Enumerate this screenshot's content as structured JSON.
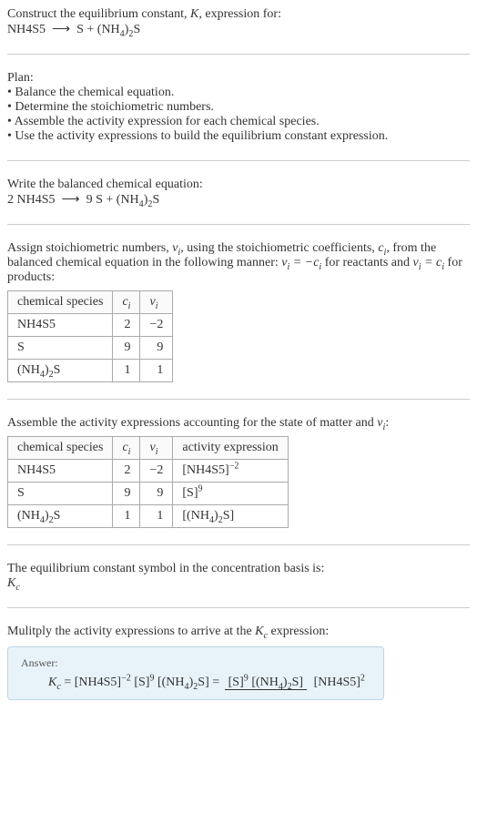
{
  "intro": {
    "line1_pre": "Construct the equilibrium constant, ",
    "K": "K",
    "line1_post": ", expression for:",
    "eq_left": "NH4S5",
    "arrow": "⟶",
    "eq_right_s": "S + (NH",
    "eq_right_end": "S"
  },
  "plan": {
    "heading": "Plan:",
    "b1": "• Balance the chemical equation.",
    "b2": "• Determine the stoichiometric numbers.",
    "b3": "• Assemble the activity expression for each chemical species.",
    "b4": "• Use the activity expressions to build the equilibrium constant expression."
  },
  "balanced": {
    "heading": "Write the balanced chemical equation:",
    "left": "2 NH4S5",
    "arrow": "⟶",
    "right_a": "9 S + (NH",
    "right_b": "S"
  },
  "assign": {
    "text_a": "Assign stoichiometric numbers, ",
    "nu": "ν",
    "text_b": ", using the stoichiometric coefficients, ",
    "ci": "c",
    "text_c": ", from the balanced chemical equation in the following manner: ",
    "rel1_a": "ν",
    "rel1_mid": " = −c",
    "rel1_post": " for reactants and ",
    "rel2_a": "ν",
    "rel2_mid": " = c",
    "rel2_post": " for products:",
    "h_species": "chemical species",
    "h_ci": "c",
    "h_nu": "ν",
    "rows": [
      {
        "sp": "NH4S5",
        "ci": "2",
        "nu": "−2"
      },
      {
        "sp": "S",
        "ci": "9",
        "nu": "9"
      },
      {
        "sp_a": "(NH",
        "sp_b": "S",
        "ci": "1",
        "nu": "1"
      }
    ]
  },
  "activity": {
    "heading_a": "Assemble the activity expressions accounting for the state of matter and ",
    "heading_nu": "ν",
    "heading_b": ":",
    "h_species": "chemical species",
    "h_ci": "c",
    "h_nu": "ν",
    "h_act": "activity expression",
    "rows": [
      {
        "sp": "NH4S5",
        "ci": "2",
        "nu": "−2",
        "act_base": "[NH4S5]",
        "act_exp": "−2"
      },
      {
        "sp": "S",
        "ci": "9",
        "nu": "9",
        "act_base": "[S]",
        "act_exp": "9"
      },
      {
        "sp_a": "(NH",
        "sp_b": "S",
        "ci": "1",
        "nu": "1",
        "act_a": "[(NH",
        "act_b": "S]"
      }
    ]
  },
  "symbol": {
    "line": "The equilibrium constant symbol in the concentration basis is:",
    "kc": "K"
  },
  "multiply": {
    "heading_a": "Mulitply the activity expressions to arrive at the ",
    "kc": "K",
    "heading_b": " expression:"
  },
  "answer": {
    "label": "Answer:",
    "kc": "K",
    "eq": " = ",
    "t1": "[NH4S5]",
    "t1e": "−2",
    "t2": " [S]",
    "t2e": "9",
    "t3a": " [(NH",
    "t3b": "S] = ",
    "num_a": "[S]",
    "num_ae": "9",
    "num_b": " [(NH",
    "num_c": "S]",
    "den_a": "[NH4S5]",
    "den_e": "2"
  },
  "subs": {
    "i": "i",
    "c": "c",
    "four": "4",
    "two_sub": "2"
  },
  "chart_data": {
    "type": "table",
    "tables": [
      {
        "title": "stoichiometric numbers",
        "columns": [
          "chemical species",
          "c_i",
          "ν_i"
        ],
        "rows": [
          [
            "NH4S5",
            2,
            -2
          ],
          [
            "S",
            9,
            9
          ],
          [
            "(NH4)2S",
            1,
            1
          ]
        ]
      },
      {
        "title": "activity expressions",
        "columns": [
          "chemical species",
          "c_i",
          "ν_i",
          "activity expression"
        ],
        "rows": [
          [
            "NH4S5",
            2,
            -2,
            "[NH4S5]^-2"
          ],
          [
            "S",
            9,
            9,
            "[S]^9"
          ],
          [
            "(NH4)2S",
            1,
            1,
            "[(NH4)2S]"
          ]
        ]
      }
    ]
  }
}
